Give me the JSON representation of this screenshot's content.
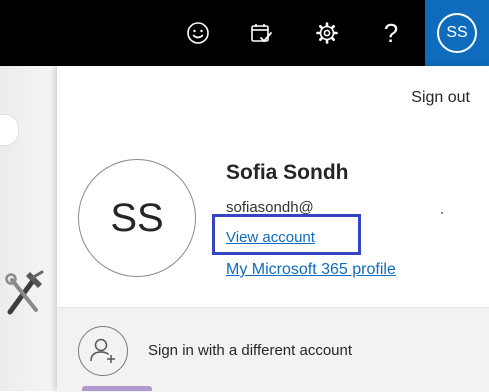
{
  "topbar": {
    "icons": [
      "smiley-icon",
      "calendar-check-icon",
      "gear-icon",
      "help-icon"
    ],
    "help_glyph": "?",
    "avatar_initials": "SS",
    "accent_color": "#0f6cbd"
  },
  "account_panel": {
    "sign_out_label": "Sign out",
    "avatar_initials": "SS",
    "name": "Sofia Sondh",
    "email": "sofiasondh@",
    "view_account_label": "View account",
    "profile_link_label": "My Microsoft 365 profile",
    "highlight_color": "#3544c0"
  },
  "other_account": {
    "label": "Sign in with a different account",
    "icon": "person-add-icon"
  }
}
